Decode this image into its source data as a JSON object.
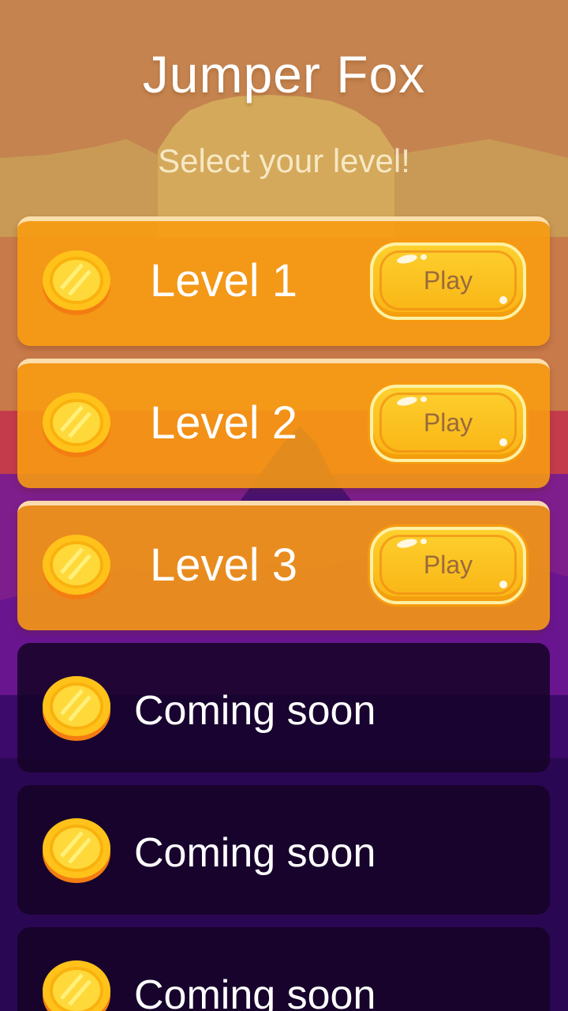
{
  "game": {
    "title": "Jumper Fox",
    "subtitle": "Select your level!"
  },
  "levels": [
    {
      "label": "Level 1",
      "button": "Play",
      "state": "unlocked"
    },
    {
      "label": "Level 2",
      "button": "Play",
      "state": "unlocked"
    },
    {
      "label": "Level 3",
      "button": "Play",
      "state": "unlocked"
    },
    {
      "label": "Coming soon",
      "state": "locked"
    },
    {
      "label": "Coming soon",
      "state": "locked"
    },
    {
      "label": "Coming soon",
      "state": "locked"
    }
  ],
  "colors": {
    "sky": "#c4834f",
    "sun": "#d6ad5a",
    "dusk": "#c43c4c",
    "purple": "#7e1e8c",
    "night": "#140226",
    "panel_orange": "#f89c10",
    "button_yellow": "#fdd02e",
    "coin_gold": "#ffd21a"
  }
}
